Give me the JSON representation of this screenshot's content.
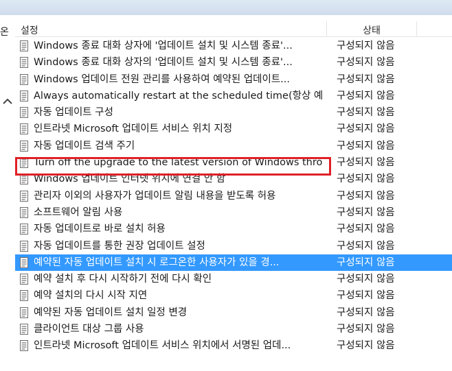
{
  "side": {
    "label": "온"
  },
  "header": {
    "setting_label": "설정",
    "state_label": "상태"
  },
  "rows": [
    {
      "name": "Windows 종료 대화 상자에 '업데이트 설치 및 시스템 종료'...",
      "state": "구성되지 않음"
    },
    {
      "name": "Windows 종료 대화 상자의 '업데이트 설치 및 시스템 종료'...",
      "state": "구성되지 않음"
    },
    {
      "name": "Windows 업데이트 전원 관리를 사용하여 예약된 업데이트...",
      "state": "구성되지 않음"
    },
    {
      "name": "Always automatically restart at the scheduled time(항상 예...",
      "state": "구성되지 않음"
    },
    {
      "name": "자동 업데이트 구성",
      "state": "구성되지 않음"
    },
    {
      "name": "인트라넷 Microsoft 업데이트 서비스 위치 지정",
      "state": "구성되지 않음"
    },
    {
      "name": "자동 업데이트 검색 주기",
      "state": "구성되지 않음"
    },
    {
      "name": "Turn off the upgrade to the latest version of Windows thro...",
      "state": "구성되지 않음"
    },
    {
      "name": "Windows 업데이트 인터넷 위치에 연결 안 함",
      "state": "구성되지 않음"
    },
    {
      "name": "관리자 이외의 사용자가 업데이트 알림 내용을 받도록 허용",
      "state": "구성되지 않음"
    },
    {
      "name": "소프트웨어 알림 사용",
      "state": "구성되지 않음"
    },
    {
      "name": "자동 업데이트로 바로 설치 허용",
      "state": "구성되지 않음"
    },
    {
      "name": "자동 업데이트를 통한 권장 업데이트 설정",
      "state": "구성되지 않음"
    },
    {
      "name": "예약된 자동 업데이트 설치 시 로그온한 사용자가 있을 경...",
      "state": "구성되지 않음"
    },
    {
      "name": "예약 설치 후 다시 시작하기 전에 다시 확인",
      "state": "구성되지 않음"
    },
    {
      "name": "예약 설치의 다시 시작 지연",
      "state": "구성되지 않음"
    },
    {
      "name": "예약된 자동 업데이트 설치 일정 변경",
      "state": "구성되지 않음"
    },
    {
      "name": "클라이언트 대상 그룹 사용",
      "state": "구성되지 않음"
    },
    {
      "name": "인트라넷 Microsoft 업데이트 서비스 위치에서 서명된 업데...",
      "state": "구성되지 않음"
    }
  ],
  "selected_row_index": 13,
  "highlighted_row_index": 7,
  "colors": {
    "selection": "#3399ff",
    "highlight_border": "#e01f26"
  },
  "icons": {
    "row_icon": "policy-setting-icon",
    "scroll_up": "chevron-up-icon"
  }
}
